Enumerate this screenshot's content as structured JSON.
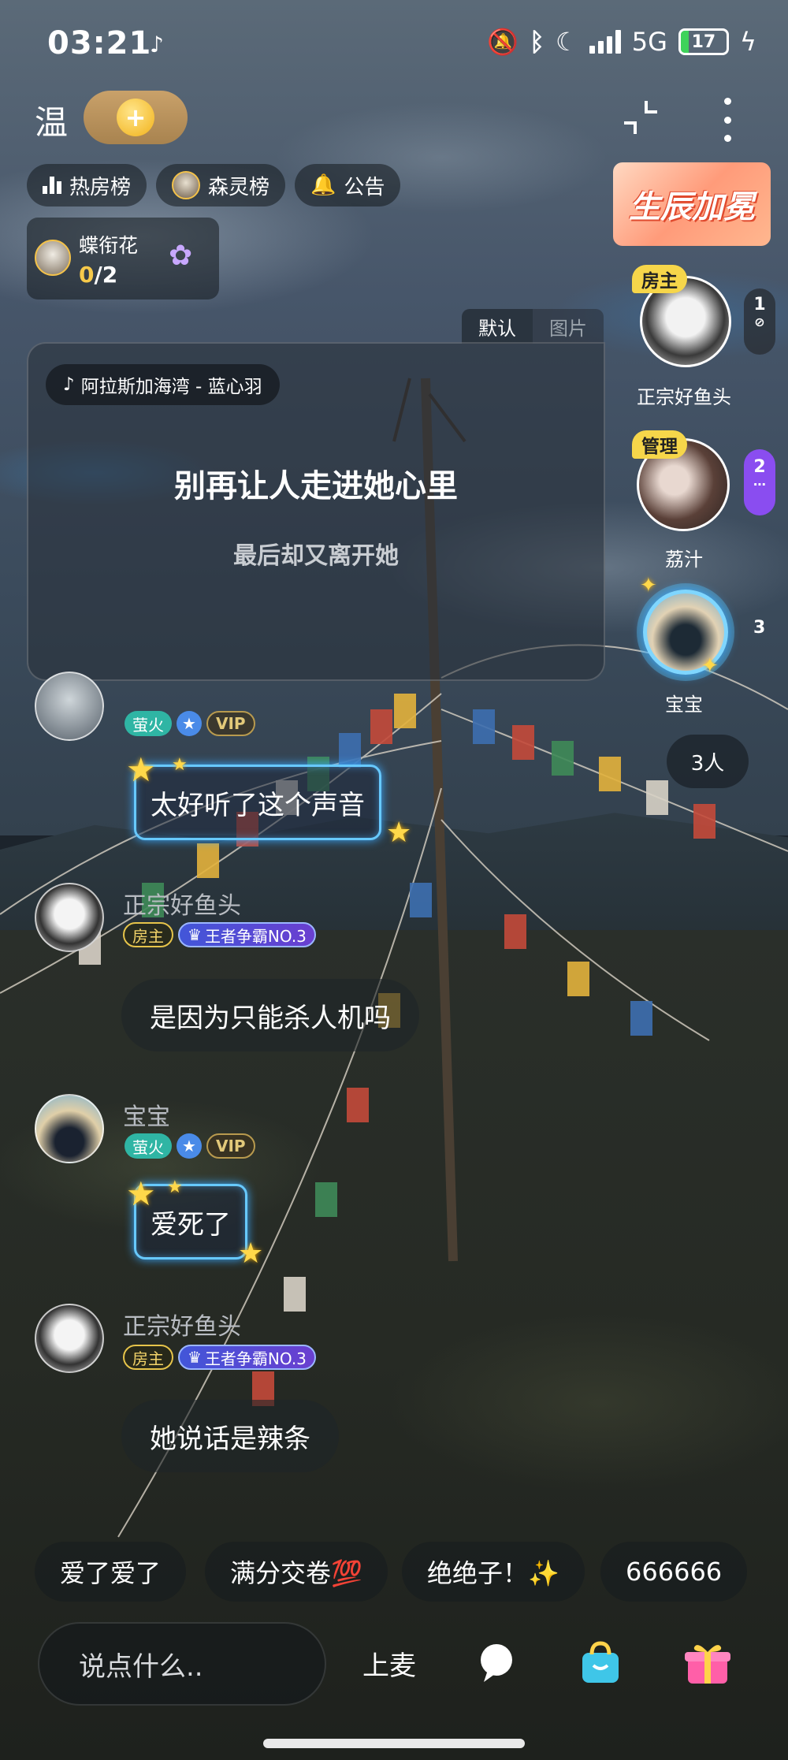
{
  "status_bar": {
    "time": "03:21",
    "network": "5G",
    "battery": "17"
  },
  "header": {
    "room_name": "温",
    "add_icon": "plus-coin-icon"
  },
  "chips": [
    {
      "label": "热房榜",
      "icon": "bar-chart-icon"
    },
    {
      "label": "森灵榜",
      "icon": "avatar-crown-icon"
    },
    {
      "label": "公告",
      "icon": "bell-icon"
    }
  ],
  "task": {
    "name": "蝶衔花",
    "done": "0",
    "total": "/2"
  },
  "banner": {
    "text": "生辰加冕"
  },
  "lyrics_tabs": {
    "default": "默认",
    "image": "图片"
  },
  "lyrics": {
    "song": "阿拉斯加海湾 - 蓝心羽",
    "current": "别再让人走进她心里",
    "next": "最后却又离开她"
  },
  "seats": [
    {
      "role": "房主",
      "name": "正宗好鱼头",
      "num": "1"
    },
    {
      "role": "管理",
      "name": "荔汁",
      "num": "2"
    },
    {
      "role": "",
      "name": "宝宝",
      "num": "3"
    }
  ],
  "online": "3人",
  "chat": [
    {
      "name": "",
      "badges": [
        "萤火",
        "VIP"
      ],
      "text": "太好听了这个声音"
    },
    {
      "name": "正宗好鱼头",
      "badges": [
        "房主",
        "王者争霸NO.3"
      ],
      "text": "是因为只能杀人机吗"
    },
    {
      "name": "宝宝",
      "badges": [
        "萤火",
        "VIP"
      ],
      "text": "爱死了"
    },
    {
      "name": "正宗好鱼头",
      "badges": [
        "房主",
        "王者争霸NO.3"
      ],
      "text": "她说话是辣条"
    }
  ],
  "quick_replies": [
    "爱了爱了",
    "满分交卷💯",
    "绝绝子！✨",
    "666666"
  ],
  "bottom": {
    "input_placeholder": "说点什么..",
    "mic_up": "上麦"
  }
}
